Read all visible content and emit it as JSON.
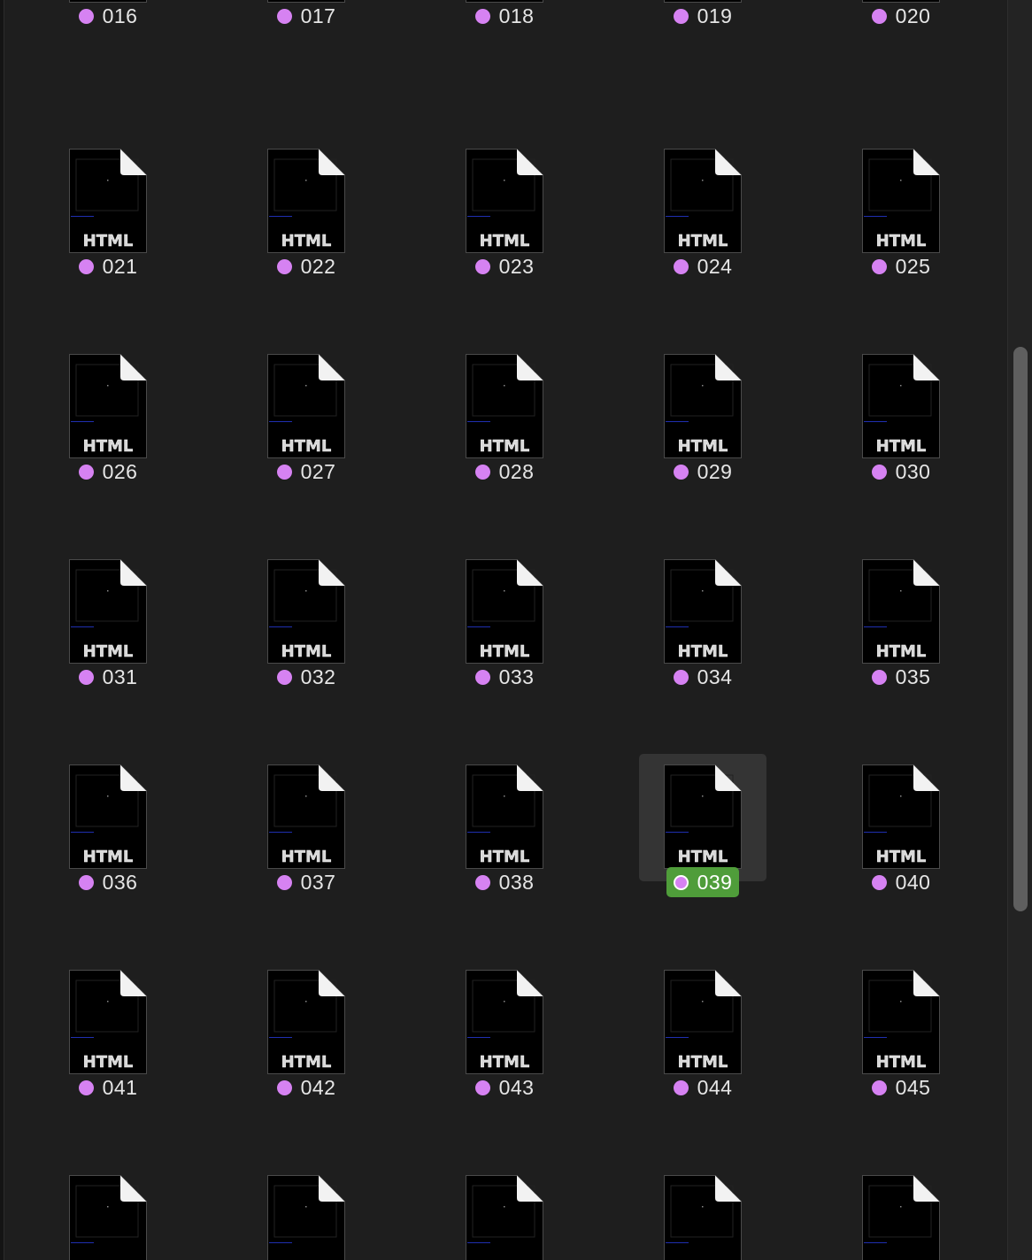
{
  "file_type_badge": "HTML",
  "tag_color": "#d682f2",
  "selection_color": "#4f9d3a",
  "selected_file": "039",
  "rows": [
    [
      "016",
      "017",
      "018",
      "019",
      "020"
    ],
    [
      "021",
      "022",
      "023",
      "024",
      "025"
    ],
    [
      "026",
      "027",
      "028",
      "029",
      "030"
    ],
    [
      "031",
      "032",
      "033",
      "034",
      "035"
    ],
    [
      "036",
      "037",
      "038",
      "039",
      "040"
    ],
    [
      "041",
      "042",
      "043",
      "044",
      "045"
    ],
    [
      "",
      "",
      "",
      "",
      ""
    ]
  ]
}
